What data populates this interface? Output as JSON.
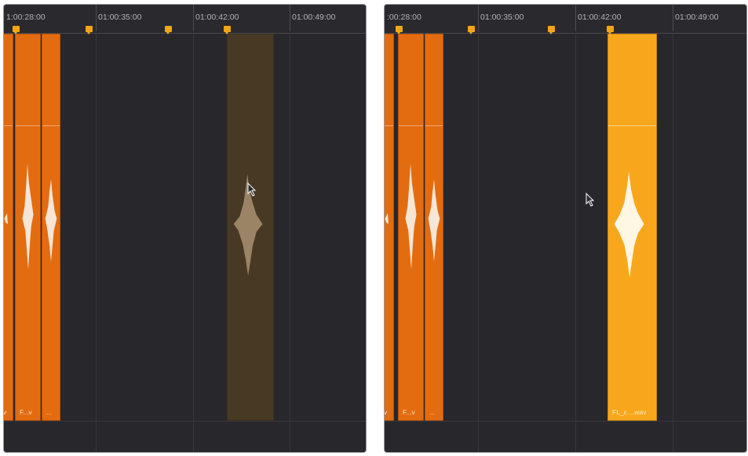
{
  "colors": {
    "background": "#28272b",
    "clip_orange": "#e36c11",
    "clip_selected": "#f8a71d",
    "ghost_clip": "#483925",
    "marker": "#f3a613"
  },
  "left_panel": {
    "timecodes": [
      "1:00:28:00",
      "01:00:35:00",
      "01:00:42:00",
      "01:00:49:00"
    ],
    "clips": [
      {
        "label": "v"
      },
      {
        "label": "F...v"
      },
      {
        "label": "..."
      }
    ],
    "ghost_clip": {
      "state": "dragging"
    },
    "cursor": "pointer-arrow-icon"
  },
  "right_panel": {
    "timecodes": [
      ":00:28:00",
      "01:00:35:00",
      "01:00:42:00",
      "01:00:49:00"
    ],
    "clips": [
      {
        "label": "v"
      },
      {
        "label": "F...v"
      },
      {
        "label": "..."
      }
    ],
    "selected_clip": {
      "label": "FL_c....wav"
    },
    "cursor": "pointer-arrow-icon"
  }
}
